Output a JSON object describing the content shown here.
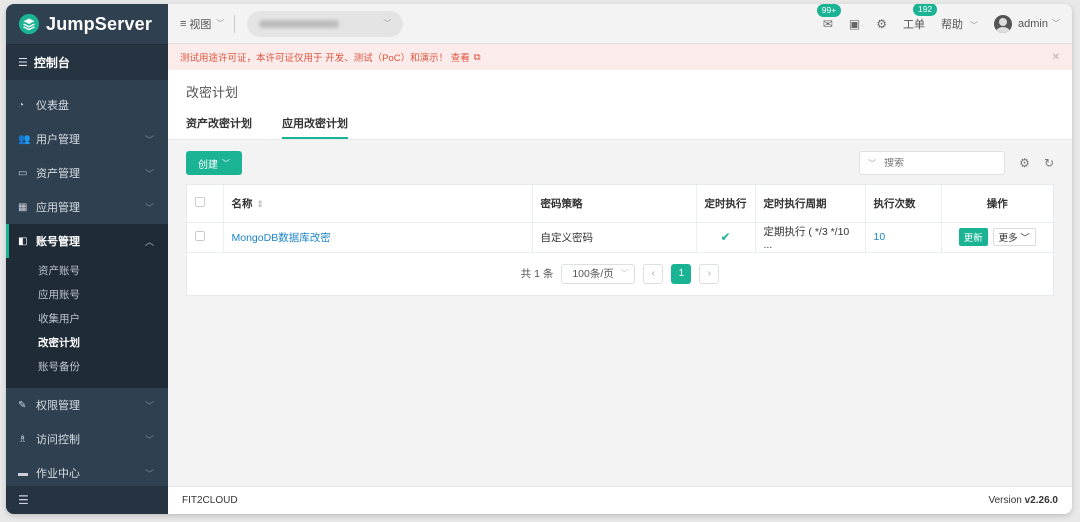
{
  "sidebar": {
    "logo": "JumpServer",
    "console": "控制台",
    "items": [
      {
        "label": "仪表盘",
        "icon": "dashboard-icon"
      },
      {
        "label": "用户管理",
        "icon": "users-icon"
      },
      {
        "label": "资产管理",
        "icon": "inbox-icon"
      },
      {
        "label": "应用管理",
        "icon": "grid-icon"
      },
      {
        "label": "账号管理",
        "icon": "account-icon"
      },
      {
        "label": "权限管理",
        "icon": "edit-icon"
      },
      {
        "label": "访问控制",
        "icon": "sitemap-icon"
      },
      {
        "label": "作业中心",
        "icon": "terminal-icon"
      }
    ],
    "sub_items": [
      "资产账号",
      "应用账号",
      "收集用户",
      "改密计划",
      "账号备份"
    ]
  },
  "topbar": {
    "view": "视图",
    "notification_badge": "99+",
    "ticket_badge": "192",
    "ticket": "工单",
    "help": "帮助",
    "user": "admin"
  },
  "license": {
    "text": "测试用途许可证，本许可证仅用于 开发、测试（PoC）和演示！ 查看"
  },
  "page": {
    "title": "改密计划",
    "tabs": [
      "资产改密计划",
      "应用改密计划"
    ]
  },
  "toolbar": {
    "create": "创建",
    "search_placeholder": "搜索"
  },
  "table": {
    "headers": [
      "名称",
      "密码策略",
      "定时执行",
      "定时执行周期",
      "执行次数",
      "操作"
    ],
    "rows": [
      {
        "name": "MongoDB数据库改密",
        "policy": "自定义密码",
        "periodic": true,
        "period": "定期执行 ( */3 */10 ...",
        "count": "10",
        "update": "更新",
        "more": "更多"
      }
    ]
  },
  "pagination": {
    "total": "共 1 条",
    "page_size": "100条/页",
    "current": "1"
  },
  "footer": {
    "brand": "FIT2CLOUD",
    "version_label": "Version",
    "version": "v2.26.0"
  },
  "colors": {
    "accent": "#1ab394",
    "sidebar": "#2f4050",
    "link": "#1c84c6",
    "alert": "#e0533d"
  }
}
